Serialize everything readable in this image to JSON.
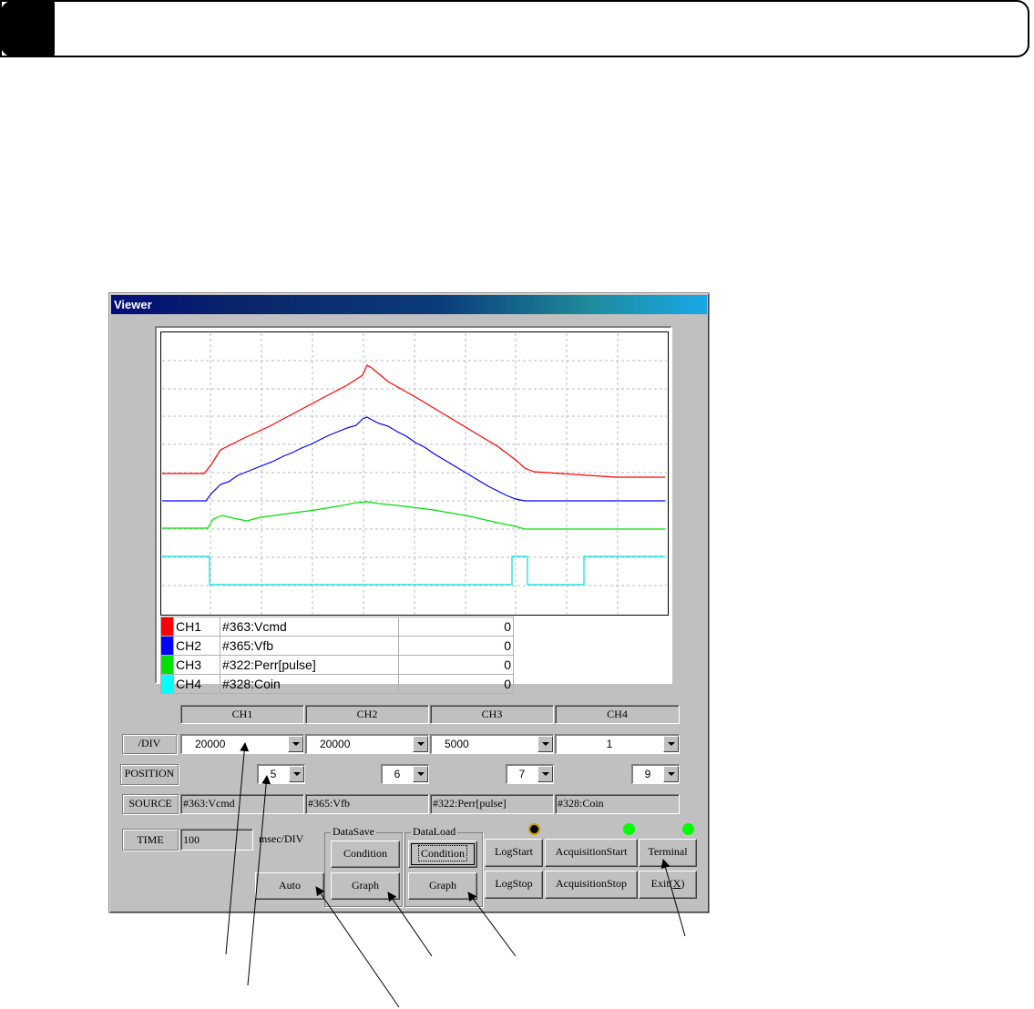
{
  "window": {
    "title": "Viewer"
  },
  "legend": [
    {
      "channel": "CH1",
      "name": "#363:Vcmd",
      "value": "0",
      "color": "#ff0000"
    },
    {
      "channel": "CH2",
      "name": "#365:Vfb",
      "value": "0",
      "color": "#0000ff"
    },
    {
      "channel": "CH3",
      "name": "#322:Perr[pulse]",
      "value": "0",
      "color": "#00e000"
    },
    {
      "channel": "CH4",
      "name": "#328:Coin",
      "value": "0",
      "color": "#00ffff"
    }
  ],
  "controls": {
    "channel_headers": [
      "CH1",
      "CH2",
      "CH3",
      "CH4"
    ],
    "div_label": "/DIV",
    "div_values": [
      "20000",
      "20000",
      "5000",
      "1"
    ],
    "position_label": "POSITION",
    "position_values": [
      "5",
      "6",
      "7",
      "9"
    ],
    "source_label": "SOURCE",
    "source_values": [
      "#363:Vcmd",
      "#365:Vfb",
      "#322:Perr[pulse]",
      "#328:Coin"
    ],
    "time_label": "TIME",
    "time_value": "100",
    "time_unit": "msec/DIV",
    "auto_button": "Auto"
  },
  "data_save": {
    "caption": "DataSave",
    "condition_button": "Condition",
    "graph_button": "Graph"
  },
  "data_load": {
    "caption": "DataLoad",
    "condition_button": "Condition",
    "graph_button": "Graph"
  },
  "log": {
    "start_button": "LogStart",
    "stop_button": "LogStop",
    "led_color": "#000000"
  },
  "acquisition": {
    "start_button": "AcquisitionStart",
    "stop_button": "AcquisitionStop",
    "led_color": "#00ff00"
  },
  "terminal": {
    "button": "Terminal",
    "led_color": "#00ff00"
  },
  "exit": {
    "label_prefix": "Exit(",
    "hotkey": "X",
    "label_suffix": ")"
  }
}
